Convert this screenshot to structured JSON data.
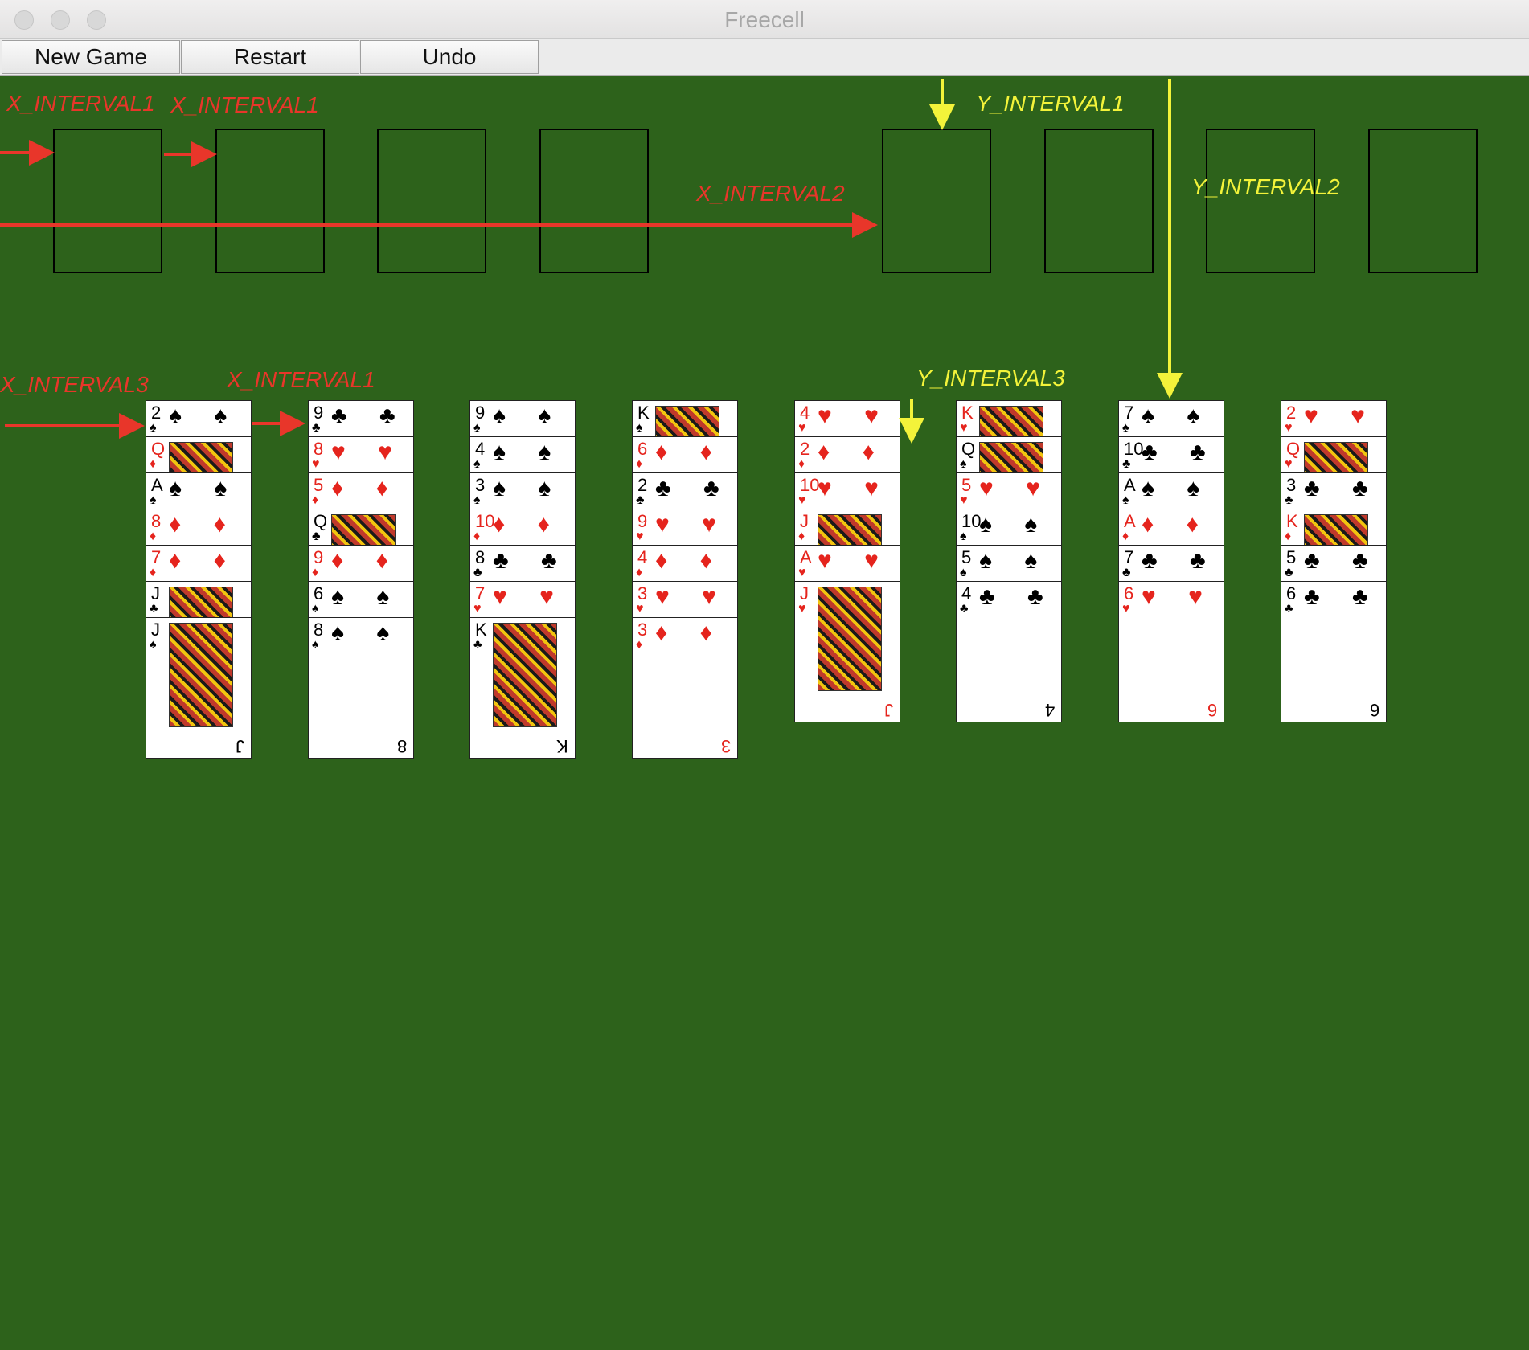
{
  "window": {
    "title": "Freecell"
  },
  "toolbar": {
    "new_game_label": "New Game",
    "restart_label": "Restart",
    "undo_label": "Undo"
  },
  "colors": {
    "felt": "#2d621b",
    "red_annotation": "#e8362a",
    "yellow_annotation": "#f3f33a"
  },
  "annotations": {
    "x_interval1": "X_INTERVAL1",
    "x_interval2": "X_INTERVAL2",
    "x_interval3": "X_INTERVAL3",
    "y_interval1": "Y_INTERVAL1",
    "y_interval2": "Y_INTERVAL2",
    "y_interval3": "Y_INTERVAL3"
  },
  "free_cells": 4,
  "foundations": 4,
  "tableau": [
    [
      {
        "r": "2",
        "s": "♠"
      },
      {
        "r": "Q",
        "s": "♦"
      },
      {
        "r": "A",
        "s": "♠"
      },
      {
        "r": "8",
        "s": "♦"
      },
      {
        "r": "7",
        "s": "♦"
      },
      {
        "r": "J",
        "s": "♣"
      },
      {
        "r": "J",
        "s": "♠"
      }
    ],
    [
      {
        "r": "9",
        "s": "♣"
      },
      {
        "r": "8",
        "s": "♥"
      },
      {
        "r": "5",
        "s": "♦"
      },
      {
        "r": "Q",
        "s": "♣"
      },
      {
        "r": "9",
        "s": "♦"
      },
      {
        "r": "6",
        "s": "♠"
      },
      {
        "r": "8",
        "s": "♠"
      }
    ],
    [
      {
        "r": "9",
        "s": "♠"
      },
      {
        "r": "4",
        "s": "♠"
      },
      {
        "r": "3",
        "s": "♠"
      },
      {
        "r": "10",
        "s": "♦"
      },
      {
        "r": "8",
        "s": "♣"
      },
      {
        "r": "7",
        "s": "♥"
      },
      {
        "r": "K",
        "s": "♣"
      }
    ],
    [
      {
        "r": "K",
        "s": "♠"
      },
      {
        "r": "6",
        "s": "♦"
      },
      {
        "r": "2",
        "s": "♣"
      },
      {
        "r": "9",
        "s": "♥"
      },
      {
        "r": "4",
        "s": "♦"
      },
      {
        "r": "3",
        "s": "♥"
      },
      {
        "r": "3",
        "s": "♦"
      }
    ],
    [
      {
        "r": "4",
        "s": "♥"
      },
      {
        "r": "2",
        "s": "♦"
      },
      {
        "r": "10",
        "s": "♥"
      },
      {
        "r": "J",
        "s": "♦"
      },
      {
        "r": "A",
        "s": "♥"
      },
      {
        "r": "J",
        "s": "♥"
      }
    ],
    [
      {
        "r": "K",
        "s": "♥"
      },
      {
        "r": "Q",
        "s": "♠"
      },
      {
        "r": "5",
        "s": "♥"
      },
      {
        "r": "10",
        "s": "♠"
      },
      {
        "r": "5",
        "s": "♠"
      },
      {
        "r": "4",
        "s": "♣"
      }
    ],
    [
      {
        "r": "7",
        "s": "♠"
      },
      {
        "r": "10",
        "s": "♣"
      },
      {
        "r": "A",
        "s": "♠"
      },
      {
        "r": "A",
        "s": "♦"
      },
      {
        "r": "7",
        "s": "♣"
      },
      {
        "r": "6",
        "s": "♥"
      }
    ],
    [
      {
        "r": "2",
        "s": "♥"
      },
      {
        "r": "Q",
        "s": "♥"
      },
      {
        "r": "3",
        "s": "♣"
      },
      {
        "r": "K",
        "s": "♦"
      },
      {
        "r": "5",
        "s": "♣"
      },
      {
        "r": "6",
        "s": "♣"
      }
    ]
  ]
}
